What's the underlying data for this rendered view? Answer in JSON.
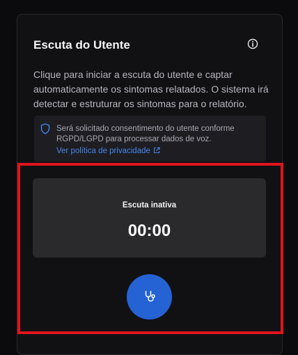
{
  "panel": {
    "title": "Escuta do Utente",
    "info_icon": "info-icon",
    "description": "Clique para iniciar a escuta do utente e captar automaticamente os sintomas relatados. O sistema irá detectar e estruturar os sintomas para o relatório."
  },
  "consent_notice": {
    "icon": "shield-icon",
    "text": "Será solicitado consentimento do utente conforme RGPD/LGPD para processar dados de voz.",
    "link_label": "Ver política de privacidade",
    "link_icon": "external-link-icon"
  },
  "recorder": {
    "status": "Escuta inativa",
    "timer": "00:00",
    "button_icon": "stethoscope-icon"
  },
  "colors": {
    "accent": "#2563d4",
    "link": "#4a86e8",
    "highlight_border": "#e0141c",
    "background": "#0b0b0d",
    "card": "#111114"
  }
}
